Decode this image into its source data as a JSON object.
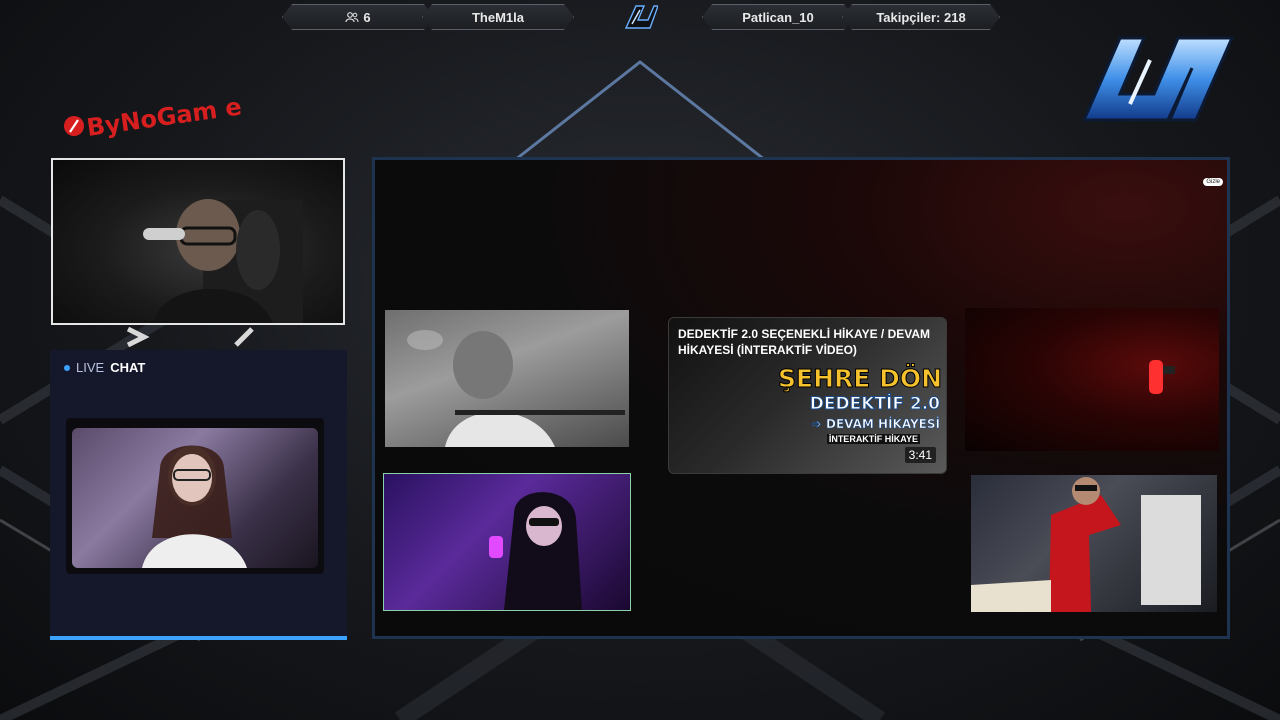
{
  "topbar": {
    "viewers": "6",
    "streamer1": "TheM1la",
    "streamer2": "Patlican_10",
    "followers": "Takipçiler: 218"
  },
  "brand": {
    "name": "ByNoGame",
    "accent": "#d81f1f"
  },
  "chat": {
    "live_label": "LIVE",
    "title": "CHAT"
  },
  "video": {
    "title": "DEDEKTİF 2.0 SEÇENEKLİ HİKAYE / DEVAM HİKAYESİ (İNTERAKTİF VİDEO)",
    "art_line1": "ŞEHRE DÖN",
    "art_line2": "DEDEKTİF 2.0",
    "art_line3": "➩ DEVAM HİKAYESİ",
    "art_line4": "İNTERAKTİF HİKAYE",
    "duration": "3:41"
  },
  "badge": "Gizle",
  "colors": {
    "accent": "#3ba3ff",
    "frame": "#1e3350"
  }
}
